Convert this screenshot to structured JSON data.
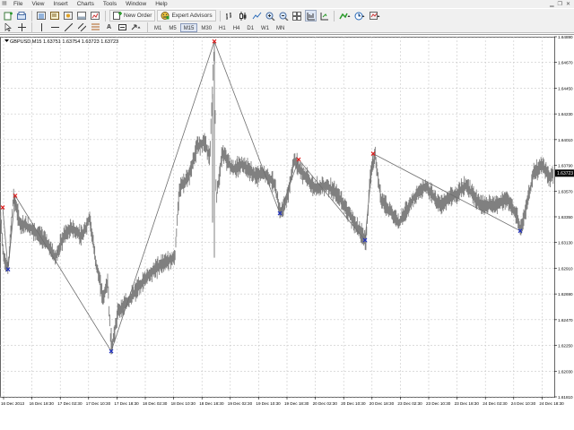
{
  "menu": {
    "items": [
      "File",
      "View",
      "Insert",
      "Charts",
      "Tools",
      "Window",
      "Help"
    ]
  },
  "toolbar": {
    "new_order_label": "New Order",
    "expert_advisors_label": "Expert Advisors",
    "timeframes": [
      "M1",
      "M5",
      "M15",
      "M30",
      "H1",
      "H4",
      "D1",
      "W1",
      "MN"
    ],
    "active_timeframe": "M15"
  },
  "chart": {
    "header": "GBPUSD,M15  1.63751 1.63754 1.63723 1.63723",
    "current_price_label": "1.63723",
    "price_ticks": [
      "1.64890",
      "1.64670",
      "1.64450",
      "1.64230",
      "1.64010",
      "1.63790",
      "1.63570",
      "1.63350",
      "1.63130",
      "1.62910",
      "1.62690",
      "1.62470",
      "1.62250",
      "1.62030",
      "1.61810"
    ],
    "time_ticks": [
      "16 Dec 2013",
      "16 Dec 18:30",
      "17 Dec 02:30",
      "17 Dec 10:30",
      "17 Dec 18:30",
      "18 Dec 02:30",
      "18 Dec 10:30",
      "18 Dec 18:30",
      "19 Dec 02:30",
      "19 Dec 10:30",
      "19 Dec 18:30",
      "20 Dec 02:30",
      "20 Dec 10:30",
      "20 Dec 18:30",
      "23 Dec 02:30",
      "23 Dec 10:30",
      "23 Dec 18:30",
      "24 Dec 02:30",
      "24 Dec 10:30",
      "24 Dec 18:30"
    ],
    "colors": {
      "price_line": "#808080",
      "zigzag": "#6e6e6e",
      "peak_marker": "#e02020",
      "trough_marker": "#2030c0",
      "grid": "#c8c8c8",
      "axis": "#000000",
      "bg": "#ffffff"
    }
  },
  "chart_data": {
    "type": "line",
    "title": "GBPUSD,M15",
    "ylim": [
      1.6181,
      1.6489
    ],
    "grid": true,
    "series": [
      {
        "name": "GBPUSD,M15",
        "x": [
          "16 Dec 2013",
          "16 Dec 18:30",
          "17 Dec 02:30",
          "17 Dec 10:30",
          "17 Dec 18:30",
          "18 Dec 02:30",
          "18 Dec 10:30",
          "18 Dec 18:30",
          "19 Dec 02:30",
          "19 Dec 10:30",
          "19 Dec 18:30",
          "20 Dec 02:30",
          "20 Dec 10:30",
          "20 Dec 18:30",
          "23 Dec 02:30",
          "23 Dec 10:30",
          "23 Dec 18:30",
          "24 Dec 02:30",
          "24 Dec 10:30",
          "24 Dec 18:30"
        ],
        "values": [
          1.6338,
          1.6305,
          1.6328,
          1.6275,
          1.6285,
          1.6352,
          1.6395,
          1.6375,
          1.6375,
          1.6355,
          1.6345,
          1.6335,
          1.634,
          1.6345,
          1.635,
          1.6355,
          1.635,
          1.6345,
          1.6365,
          1.6372
        ]
      }
    ],
    "zigzag": [
      {
        "time": "16 Dec 2013",
        "price": 1.6343,
        "kind": "peak"
      },
      {
        "time": "16 Dec 2013",
        "price": 1.629,
        "kind": "trough"
      },
      {
        "time": "16 Dec 2013",
        "price": 1.6353,
        "kind": "peak"
      },
      {
        "time": "17 Dec 10:30",
        "price": 1.622,
        "kind": "trough"
      },
      {
        "time": "18 Dec 10:30",
        "price": 1.6485,
        "kind": "peak"
      },
      {
        "time": "19 Dec 02:30",
        "price": 1.6338,
        "kind": "trough"
      },
      {
        "time": "19 Dec 10:30",
        "price": 1.6384,
        "kind": "peak"
      },
      {
        "time": "20 Dec 02:30",
        "price": 1.6315,
        "kind": "trough"
      },
      {
        "time": "20 Dec 10:30",
        "price": 1.6389,
        "kind": "peak"
      },
      {
        "time": "24 Dec 10:30",
        "price": 1.6323,
        "kind": "trough"
      }
    ]
  }
}
